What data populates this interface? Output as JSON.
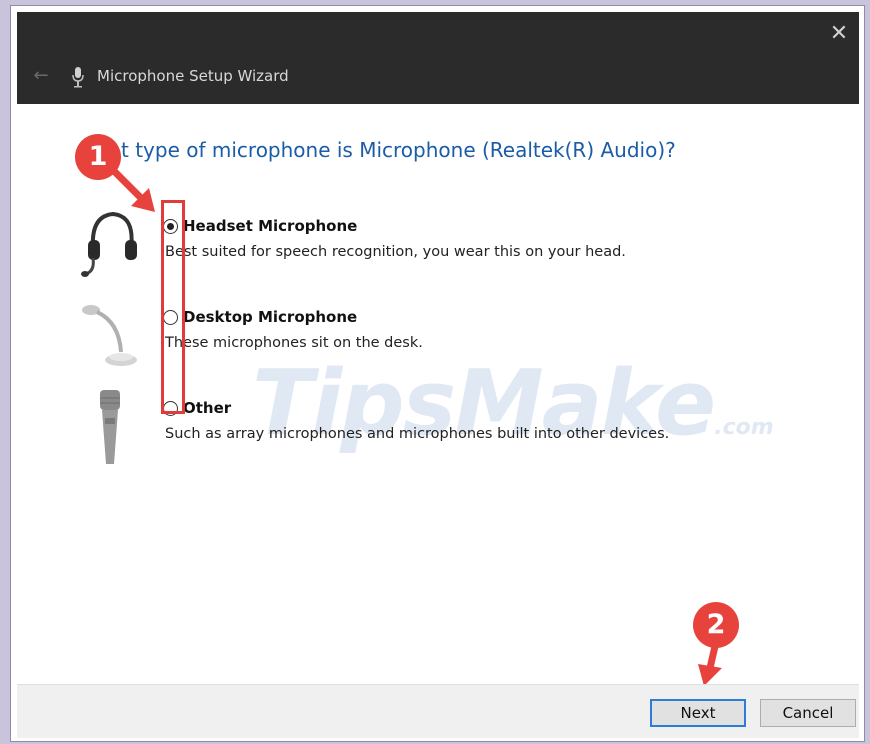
{
  "window": {
    "title": "Microphone Setup Wizard",
    "close_glyph": "✕",
    "back_glyph": "←"
  },
  "question": {
    "visible_text": "t type of microphone is Microphone (Realtek(R) Audio)?"
  },
  "options": [
    {
      "title": "Headset Microphone",
      "description": "Best suited for speech recognition, you wear this on your head.",
      "selected": true,
      "icon": "headset-icon"
    },
    {
      "title": "Desktop Microphone",
      "description": "These microphones sit on the desk.",
      "selected": false,
      "icon": "desktop-mic-icon"
    },
    {
      "title": "Other",
      "description": "Such as array microphones and microphones built into other devices.",
      "selected": false,
      "icon": "handheld-mic-icon"
    }
  ],
  "annotations": {
    "step1": "1",
    "step2": "2",
    "color": "#e8423d"
  },
  "watermark": {
    "brand": "TipsMake",
    "suffix": ".com"
  },
  "footer": {
    "next_label": "Next",
    "cancel_label": "Cancel"
  },
  "colors": {
    "titlebar_bg": "#2b2b2b",
    "question_text": "#1b5ca8",
    "focus_border": "#2f7bd6"
  }
}
